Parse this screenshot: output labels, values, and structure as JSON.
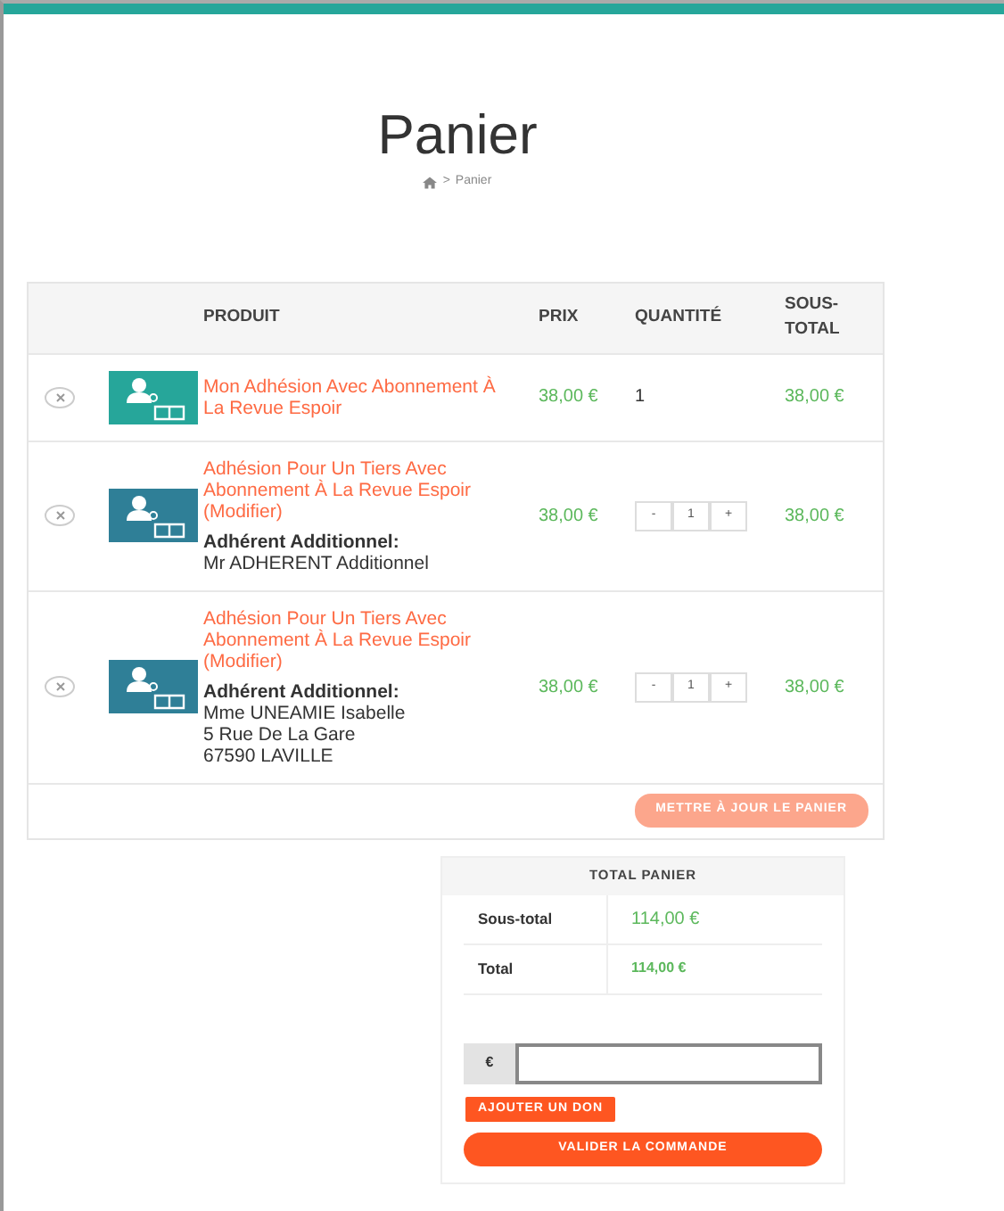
{
  "page": {
    "title": "Panier",
    "breadcrumb": [
      ">",
      "Panier"
    ]
  },
  "cart": {
    "columns": [
      "PRODUIT",
      "PRIX",
      "QUANTITÉ",
      "SOUS-TOTAL"
    ],
    "items": [
      {
        "name": "Mon Adhésion Avec Abonnement À La Revue Espoir",
        "color": "#26a69a",
        "price": "38,00 €",
        "kind": "fixed",
        "quantity": "1",
        "subtotal": "38,00 €"
      },
      {
        "name": "Adhésion Pour Un Tiers Avec Abonnement À La Revue Espoir (Modifier)",
        "color": "#2f7f97",
        "details": [
          "Adhérent Additionnel:",
          "Mr ADHERENT Additionnel"
        ],
        "price": "38,00 €",
        "kind": "stepper",
        "minus": "-",
        "quantity": "1",
        "plus": "+",
        "subtotal": "38,00 €"
      },
      {
        "name": "Adhésion Pour Un Tiers Avec Abonnement À La Revue Espoir (Modifier)",
        "color": "#2f7f97",
        "details": [
          "Adhérent Additionnel:",
          "Mme UNEAMIE Isabelle",
          "5 Rue De La Gare",
          "67590 LAVILLE"
        ],
        "price": "38,00 €",
        "kind": "stepper",
        "minus": "-",
        "quantity": "1",
        "plus": "+",
        "subtotal": "38,00 €"
      }
    ],
    "update_button": "METTRE À JOUR LE PANIER"
  },
  "totals": {
    "title": "TOTAL PANIER",
    "rows": [
      {
        "label": "Sous-total",
        "value": "114,00 €"
      },
      {
        "label": "Total",
        "value": "114,00 €"
      }
    ],
    "donation": {
      "currency": "€",
      "button": "AJOUTER UN DON"
    },
    "checkout_button": "VALIDER LA COMMANDE"
  }
}
